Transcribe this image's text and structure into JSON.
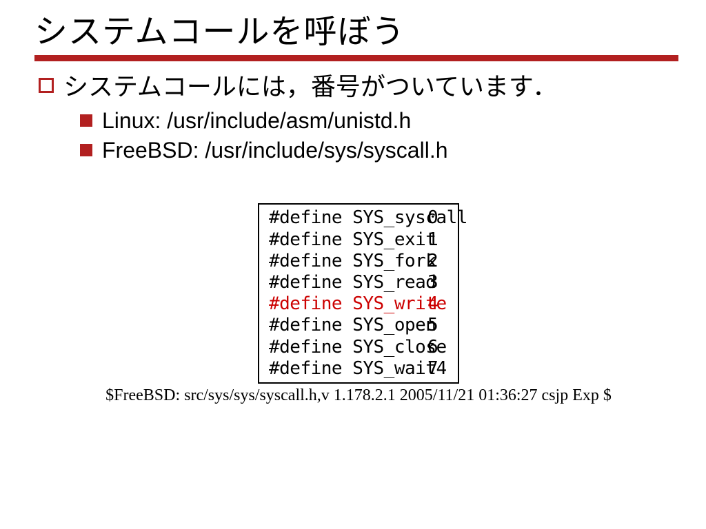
{
  "title": "システムコールを呼ぼう",
  "bullets": {
    "lvl1": "システムコールには，番号がついています．",
    "lvl2": [
      "Linux: /usr/include/asm/unistd.h",
      "FreeBSD: /usr/include/sys/syscall.h"
    ]
  },
  "code": {
    "rows": [
      {
        "name": "#define SYS_syscall",
        "idx": "0",
        "highlight": false
      },
      {
        "name": "#define SYS_exit",
        "idx": "1",
        "highlight": false
      },
      {
        "name": "#define SYS_fork",
        "idx": "2",
        "highlight": false
      },
      {
        "name": "#define SYS_read",
        "idx": "3",
        "highlight": false
      },
      {
        "name": "#define SYS_write",
        "idx": "4",
        "highlight": true
      },
      {
        "name": "#define SYS_open",
        "idx": "5",
        "highlight": false
      },
      {
        "name": "#define SYS_close",
        "idx": "6",
        "highlight": false
      },
      {
        "name": "#define SYS_wait4",
        "idx": "7",
        "highlight": false
      }
    ]
  },
  "caption": "$FreeBSD: src/sys/sys/syscall.h,v 1.178.2.1 2005/11/21 01:36:27 csjp Exp $"
}
